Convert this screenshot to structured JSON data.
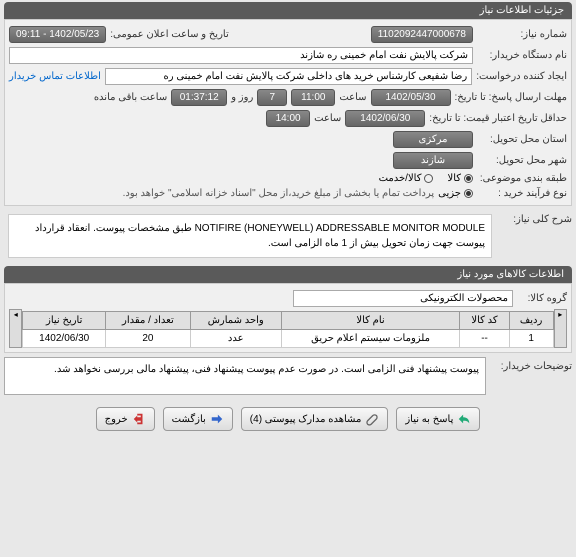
{
  "header": {
    "title": "جزئیات اطلاعات نیاز"
  },
  "fields": {
    "need_no_label": "شماره نیاز:",
    "need_no": "1102092447000678",
    "announce_label": "تاریخ و ساعت اعلان عمومی:",
    "announce_val": "1402/05/23 - 09:11",
    "buyer_label": "نام دستگاه خریدار:",
    "buyer_val": "شرکت پالایش نفت امام خمینی ره  شازند",
    "requester_label": "ایجاد کننده درخواست:",
    "requester_val": "رضا  شفیعی  کارشناس خرید های داخلی  شرکت پالایش نفت امام خمینی  ره",
    "contact_link": "اطلاعات تماس خریدار",
    "reply_deadline_label": "مهلت ارسال پاسخ: تا تاریخ:",
    "reply_date": "1402/05/30",
    "reply_time_label": "ساعت",
    "reply_time": "11:00",
    "days_label": "روز و",
    "days_val": "7",
    "countdown": "01:37:12",
    "remain_label": "ساعت باقی مانده",
    "price_valid_label": "حداقل تاریخ اعتبار قیمت: تا تاریخ:",
    "price_date": "1402/06/30",
    "price_time_label": "ساعت",
    "price_time": "14:00",
    "delivery_prov_label": "استان محل تحویل:",
    "delivery_prov": "مرکزی",
    "delivery_city_label": "شهر محل تحویل:",
    "delivery_city": "شازند",
    "budget_label": "طبقه بندی موضوعی:",
    "budget_kala": "کالا",
    "budget_service": "کالا/خدمت",
    "purchase_type_label": "نوع فرآیند خرید :",
    "purchase_partial": "جزیی",
    "purchase_note": "پرداخت تمام یا بخشی از مبلغ خرید،از محل \"اسناد خزانه اسلامی\" خواهد بود.",
    "partial_dot": "●"
  },
  "desc": {
    "label": "شرح کلی نیاز:",
    "text": "NOTIFIRE (HONEYWELL) ADDRESSABLE MONITOR MODULE طبق مشخصات پیوست. انعقاد قرارداد پیوست جهت زمان تحویل بیش از 1 ماه الزامی است."
  },
  "items_header": {
    "title": "اطلاعات کالاهای مورد نیاز"
  },
  "group_label": "گروه کالا:",
  "group_val": "محصولات الکترونیکی",
  "table": {
    "cols": [
      "ردیف",
      "کد کالا",
      "نام کالا",
      "واحد شمارش",
      "تعداد / مقدار",
      "تاریخ نیاز"
    ],
    "rows": [
      {
        "r": "1",
        "code": "--",
        "name": "ملزومات سیستم اعلام حریق",
        "unit": "عدد",
        "qty": "20",
        "date": "1402/06/30"
      }
    ]
  },
  "buyer_notes": {
    "label": "توضیحات خریدار:",
    "text": "پیوست پیشنهاد فنی الزامی است. در صورت عدم پیوست پیشنهاد فنی، پیشنهاد مالی بررسی نخواهد شد."
  },
  "buttons": {
    "reply": "پاسخ به نیاز",
    "attach": "مشاهده مدارک پیوستی (4)",
    "back": "بازگشت",
    "exit": "خروج"
  }
}
